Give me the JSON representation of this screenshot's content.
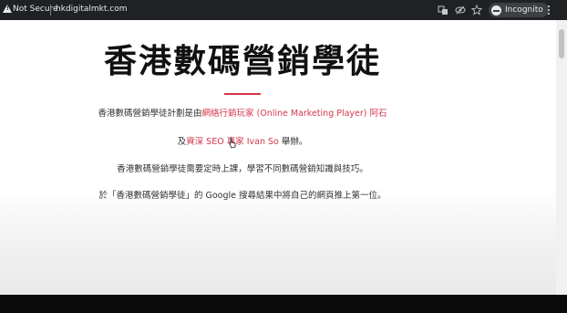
{
  "browser": {
    "security_label": "Not Secure",
    "url": "hkdigitalmkt.com",
    "incognito_label": "Incognito"
  },
  "page": {
    "title": "香港數碼營銷學徒",
    "para1": {
      "text1": "香港數碼營銷學徒計劃是由",
      "link1": "網絡行銷玩家 (Online Marketing Player) 阿石",
      "text2": "及",
      "link2": "資深 SEO 專家 Ivan So",
      "text3": " 舉辦。"
    },
    "para2": "香港數碼營銷學徒需要定時上課，學習不同數碼營銷知識與技巧。",
    "para3": "於「香港數碼營銷學徒」的 Google 搜尋結果中將自己的網頁推上第一位。"
  },
  "colors": {
    "accent": "#d4374b",
    "chrome": "#202124"
  },
  "icons": [
    "warning-icon",
    "translate-icon",
    "eye-off-icon",
    "star-icon",
    "incognito-icon",
    "more-icon",
    "pointer-cursor-icon"
  ]
}
